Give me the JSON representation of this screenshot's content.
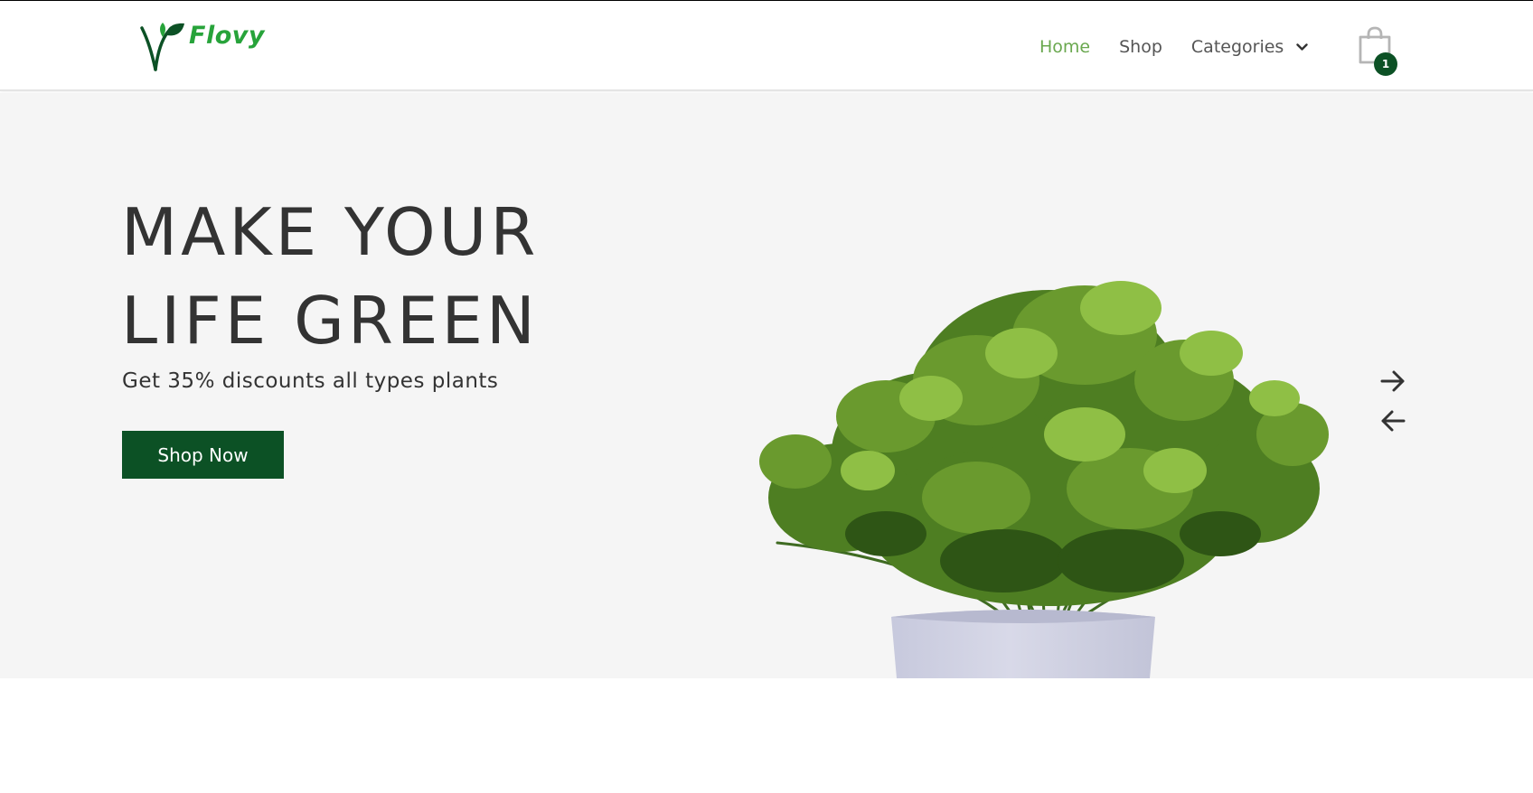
{
  "brand": {
    "name": "Flovy",
    "logo_icon": "leaf-v-logo",
    "colors": {
      "logo_green": "#27a33a",
      "logo_dark": "#0c5125"
    }
  },
  "nav": {
    "items": [
      {
        "label": "Home",
        "active": true
      },
      {
        "label": "Shop",
        "active": false
      },
      {
        "label": "Categories",
        "active": false,
        "icon": "chevron-down-icon"
      }
    ],
    "active_color": "#6aa84f",
    "text_color": "#555555"
  },
  "cart": {
    "icon": "shopping-bag-icon",
    "count": "1",
    "badge_color": "#0c5125"
  },
  "hero": {
    "headline_line1": "MAKE YOUR",
    "headline_line2": "LIFE GREEN",
    "subtitle": "Get 35% discounts all types plants",
    "cta_label": "Shop Now",
    "cta_color": "#0c5125",
    "background": "#f5f5f5",
    "image": "potted-plant-image",
    "controls": {
      "next_icon": "arrow-right-icon",
      "prev_icon": "arrow-left-icon"
    }
  }
}
